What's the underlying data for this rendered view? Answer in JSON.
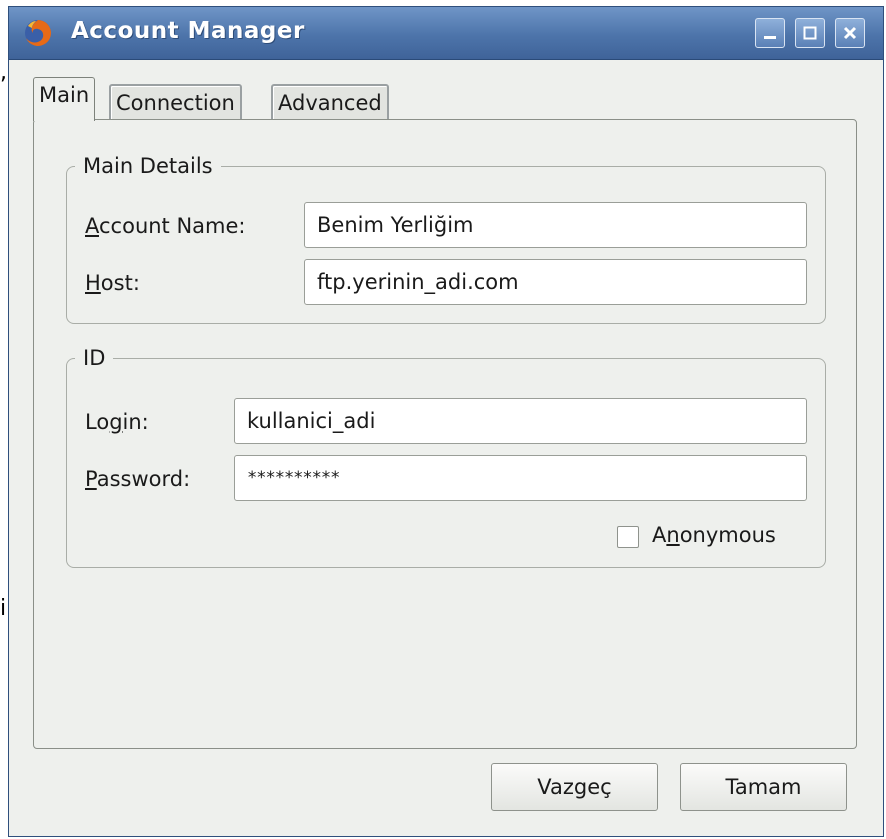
{
  "window": {
    "title": "Account Manager",
    "title_bar_color": "#4d74aa",
    "app_icon": "firefox-icon"
  },
  "background_fragments": [
    ",",
    "i"
  ],
  "tabs": [
    {
      "label": "Main",
      "active": true
    },
    {
      "label": "Connection",
      "active": false
    },
    {
      "label": "Advanced",
      "active": false
    }
  ],
  "main_details": {
    "legend": "Main Details",
    "account_name_label_ul": "A",
    "account_name_label_rest": "ccount Name:",
    "account_name_value": "Benim Yerliğim",
    "host_label_ul": "H",
    "host_label_rest": "ost:",
    "host_value": "ftp.yerinin_adi.com"
  },
  "id_group": {
    "legend": "ID",
    "login_label_pre": "Lo",
    "login_label_ul": "g",
    "login_label_post": "in:",
    "login_value": "kullanici_adi",
    "password_label_ul": "P",
    "password_label_rest": "assword:",
    "password_value": "**********",
    "anonymous_label_pre": "A",
    "anonymous_label_ul": "n",
    "anonymous_label_post": "onymous",
    "anonymous_checked": false
  },
  "buttons": {
    "cancel": "Vazgeç",
    "ok": "Tamam"
  }
}
